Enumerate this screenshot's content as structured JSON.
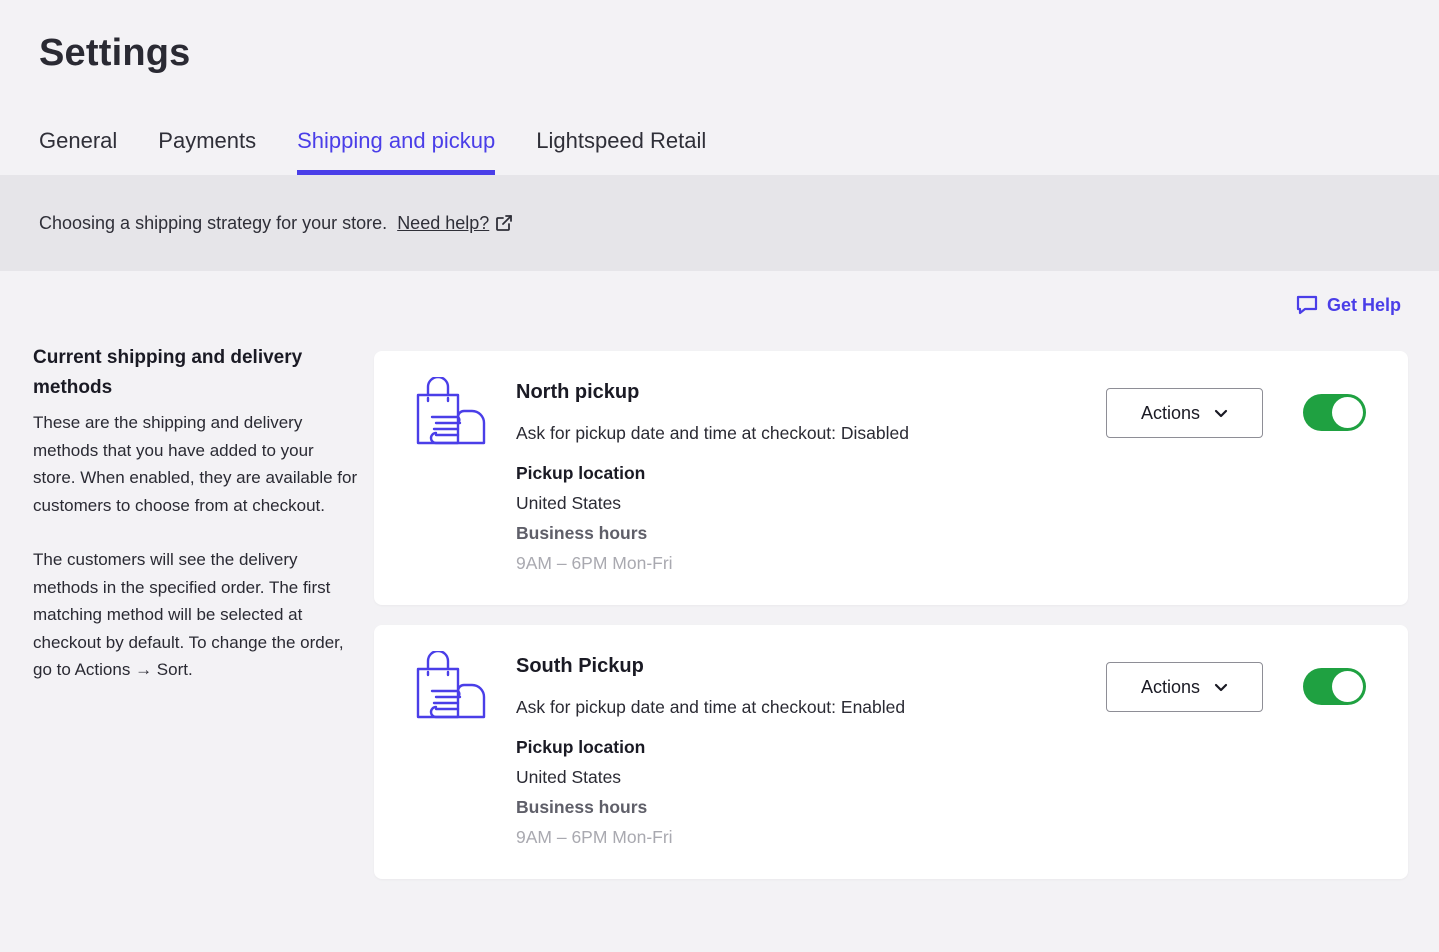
{
  "page": {
    "title": "Settings"
  },
  "tabs": [
    {
      "label": "General",
      "active": false
    },
    {
      "label": "Payments",
      "active": false
    },
    {
      "label": "Shipping and pickup",
      "active": true
    },
    {
      "label": "Lightspeed Retail",
      "active": false
    }
  ],
  "banner": {
    "text": "Choosing a shipping strategy for your store.",
    "link_label": "Need help?",
    "link_icon": "external-link-icon"
  },
  "get_help": {
    "label": "Get Help",
    "icon": "chat-bubble-icon"
  },
  "sidebar": {
    "heading": "Current shipping and delivery methods",
    "paragraph1": "These are the shipping and delivery methods that you have added to your store. When enabled, they are available for customers to choose from at checkout.",
    "paragraph2": "The customers will see the delivery methods in the specified order. The first matching method will be selected at checkout by default. To change the order, go to Actions → Sort."
  },
  "methods": [
    {
      "name": "North pickup",
      "icon": "pickup-bag-hand-icon",
      "ask_text": "Ask for pickup date and time at checkout: Disabled",
      "location_label": "Pickup location",
      "location_value": "United States",
      "hours_label": "Business hours",
      "hours_value": "9AM – 6PM Mon-Fri",
      "actions_label": "Actions",
      "enabled": true
    },
    {
      "name": "South Pickup",
      "icon": "pickup-bag-hand-icon",
      "ask_text": "Ask for pickup date and time at checkout: Enabled",
      "location_label": "Pickup location",
      "location_value": "United States",
      "hours_label": "Business hours",
      "hours_value": "9AM – 6PM Mon-Fri",
      "actions_label": "Actions",
      "enabled": true
    }
  ],
  "colors": {
    "accent": "#4a3ee8",
    "toggle_on": "#1fa141",
    "background": "#f3f2f5",
    "banner": "#e6e5e9"
  }
}
